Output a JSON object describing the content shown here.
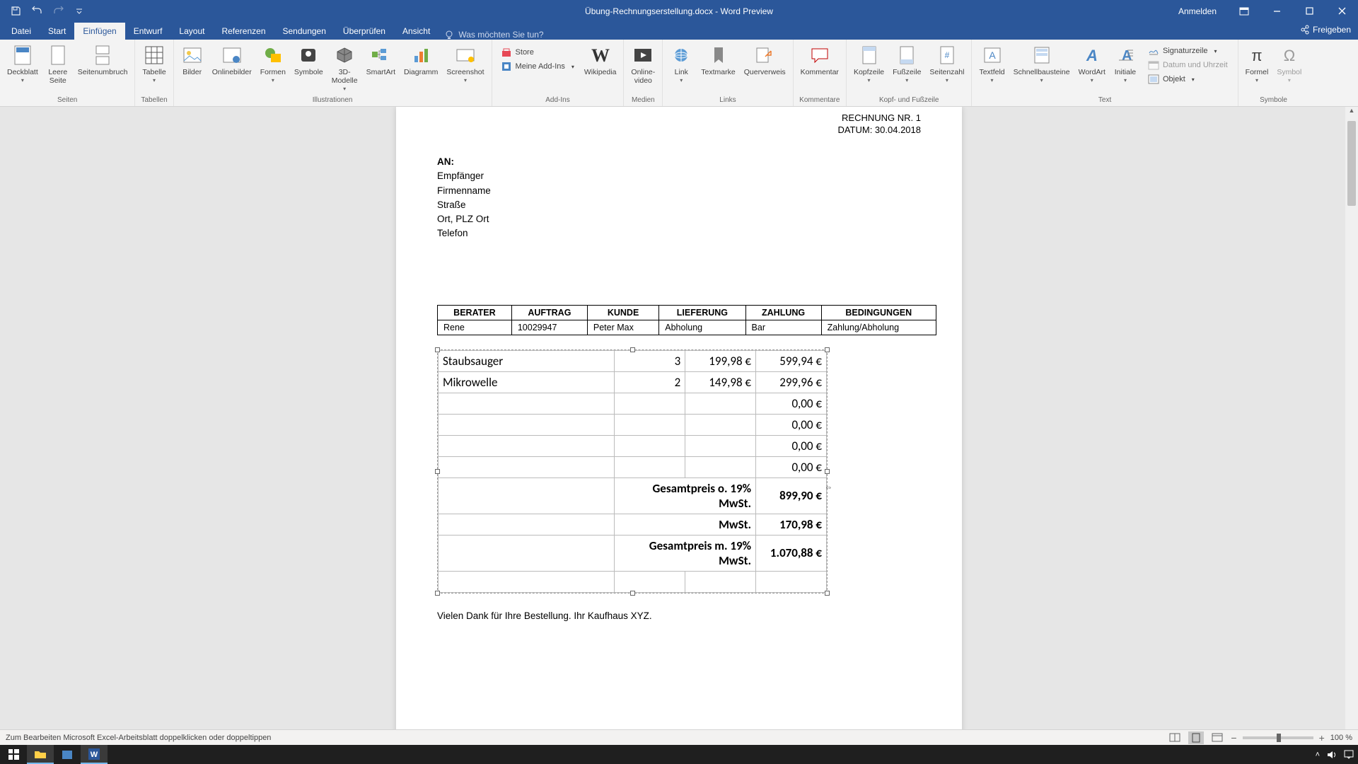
{
  "title": "Übung-Rechnungserstellung.docx - Word Preview",
  "signin": "Anmelden",
  "tabs": {
    "datei": "Datei",
    "start": "Start",
    "einfuegen": "Einfügen",
    "entwurf": "Entwurf",
    "layout": "Layout",
    "referenzen": "Referenzen",
    "sendungen": "Sendungen",
    "ueberpruefen": "Überprüfen",
    "ansicht": "Ansicht",
    "tellme": "Was möchten Sie tun?",
    "share": "Freigeben"
  },
  "ribbon": {
    "seiten": {
      "label": "Seiten",
      "deckblatt": "Deckblatt",
      "leere": "Leere\nSeite",
      "umbruch": "Seitenumbruch"
    },
    "tabellen": {
      "label": "Tabellen",
      "tabelle": "Tabelle"
    },
    "illustrationen": {
      "label": "Illustrationen",
      "bilder": "Bilder",
      "online": "Onlinebilder",
      "formen": "Formen",
      "symbole": "Symbole",
      "dmodelle": "3D-\nModelle",
      "smartart": "SmartArt",
      "diagramm": "Diagramm",
      "screenshot": "Screenshot"
    },
    "addins": {
      "label": "Add-Ins",
      "store": "Store",
      "meine": "Meine Add-Ins",
      "wikipedia": "Wikipedia"
    },
    "medien": {
      "label": "Medien",
      "video": "Online-\nvideo"
    },
    "links": {
      "label": "Links",
      "link": "Link",
      "textmarke": "Textmarke",
      "querverweis": "Querverweis"
    },
    "kommentare": {
      "label": "Kommentare",
      "kommentar": "Kommentar"
    },
    "kopf": {
      "label": "Kopf- und Fußzeile",
      "kopfzeile": "Kopfzeile",
      "fusszeile": "Fußzeile",
      "seitenzahl": "Seitenzahl"
    },
    "text": {
      "label": "Text",
      "textfeld": "Textfeld",
      "schnell": "Schnellbausteine",
      "wordart": "WordArt",
      "initiale": "Initiale",
      "signatur": "Signaturzeile",
      "datum": "Datum und Uhrzeit",
      "objekt": "Objekt"
    },
    "symbole2": {
      "label": "Symbole",
      "formel": "Formel",
      "symbol": "Symbol"
    }
  },
  "invoice": {
    "nr": "RECHNUNG NR. 1",
    "datum": "DATUM: 30.04.2018",
    "an": "AN:",
    "recipient": [
      "Empfänger",
      "Firmenname",
      "Straße",
      "Ort, PLZ Ort",
      "Telefon"
    ],
    "meta_headers": [
      "BERATER",
      "AUFTRAG",
      "KUNDE",
      "LIEFERUNG",
      "ZAHLUNG",
      "BEDINGUNGEN"
    ],
    "meta_values": [
      "Rene",
      "10029947",
      "Peter Max",
      "Abholung",
      "Bar",
      "Zahlung/Abholung"
    ],
    "thanks": "Vielen Dank für Ihre Bestellung. Ihr Kaufhaus XYZ."
  },
  "chart_data": {
    "type": "table",
    "items": [
      {
        "desc": "Staubsauger",
        "qty": "3",
        "unit": "199,98 €",
        "total": "599,94 €"
      },
      {
        "desc": "Mikrowelle",
        "qty": "2",
        "unit": "149,98 €",
        "total": "299,96 €"
      },
      {
        "desc": "",
        "qty": "",
        "unit": "",
        "total": "0,00 €"
      },
      {
        "desc": "",
        "qty": "",
        "unit": "",
        "total": "0,00 €"
      },
      {
        "desc": "",
        "qty": "",
        "unit": "",
        "total": "0,00 €"
      },
      {
        "desc": "",
        "qty": "",
        "unit": "",
        "total": "0,00 €"
      }
    ],
    "summary": [
      {
        "label": "Gesamtpreis o. 19% MwSt.",
        "value": "899,90 €",
        "bold": true
      },
      {
        "label": "MwSt.",
        "value": "170,98 €",
        "bold": true
      },
      {
        "label": "Gesamtpreis m. 19% MwSt.",
        "value": "1.070,88 €",
        "bold": true
      }
    ]
  },
  "status": {
    "hint": "Zum Bearbeiten Microsoft Excel-Arbeitsblatt doppelklicken oder doppeltippen",
    "zoom": "100 %"
  },
  "taskbar": {
    "time": " "
  }
}
